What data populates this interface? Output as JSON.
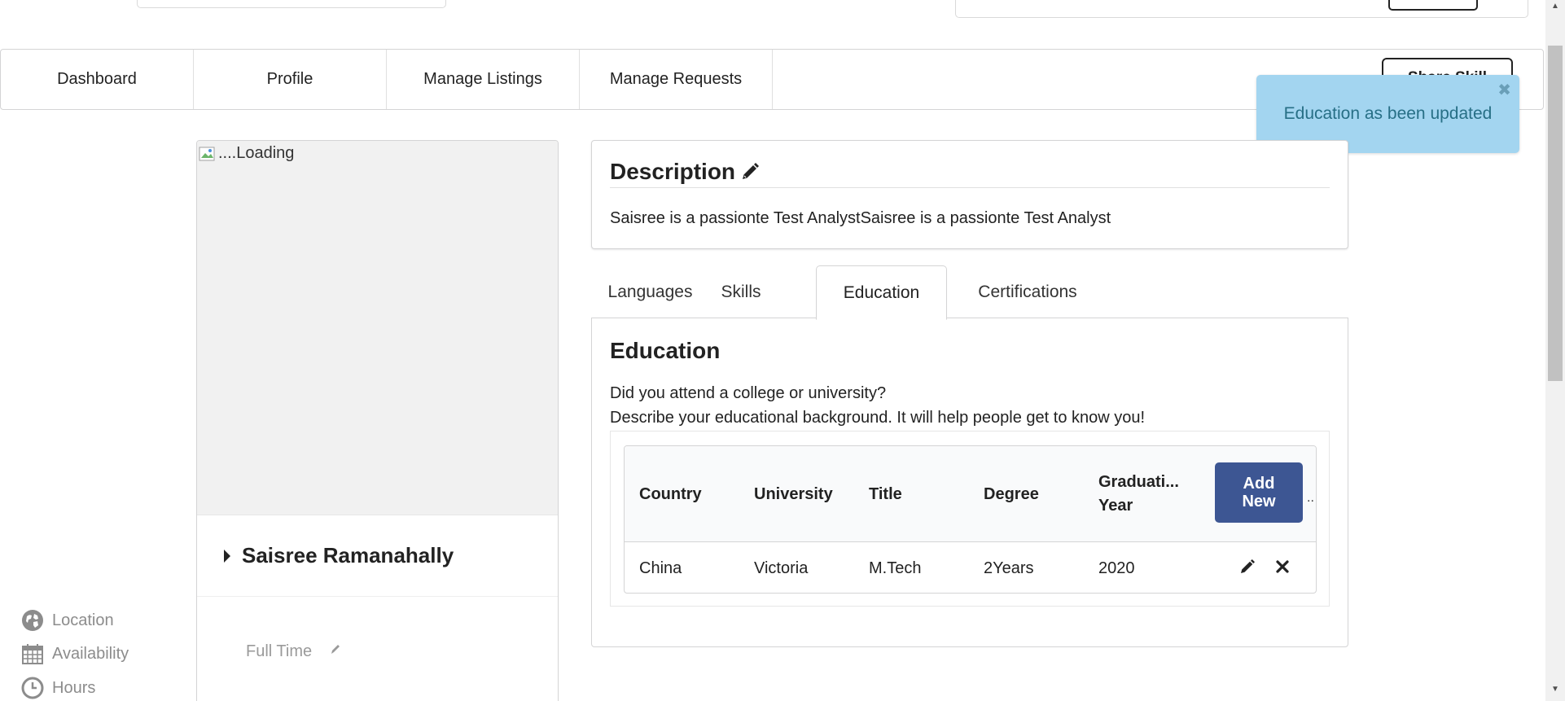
{
  "nav": {
    "items": [
      "Dashboard",
      "Profile",
      "Manage Listings",
      "Manage Requests"
    ],
    "share_label": "Share Skill"
  },
  "toast": {
    "message": "Education as been updated",
    "close_icon": "close-icon"
  },
  "profile": {
    "image_alt": "....Loading",
    "name": "Saisree Ramanahally",
    "location_label": "Location",
    "availability_label": "Availability",
    "availability_value": "Full Time",
    "hours_label": "Hours"
  },
  "description": {
    "title": "Description",
    "text": "Saisree is a passionte Test AnalystSaisree is a passionte Test Analyst"
  },
  "tabs": {
    "items": [
      "Languages",
      "Skills",
      "Education",
      "Certifications"
    ],
    "active": "Education"
  },
  "education": {
    "title": "Education",
    "question": "Did you attend a college or university?",
    "description": "Describe your educational background. It will help people get to know you!",
    "columns": [
      "Country",
      "University",
      "Title",
      "Degree",
      "Graduati... Year"
    ],
    "add_button": "Add New",
    "overflow": "..",
    "rows": [
      {
        "country": "China",
        "university": "Victoria",
        "title": "M.Tech",
        "degree": "2Years",
        "year": "2020"
      }
    ]
  },
  "colors": {
    "accent": "#3d5693",
    "toast_bg": "#a3d5f0",
    "toast_text": "#276f86"
  }
}
